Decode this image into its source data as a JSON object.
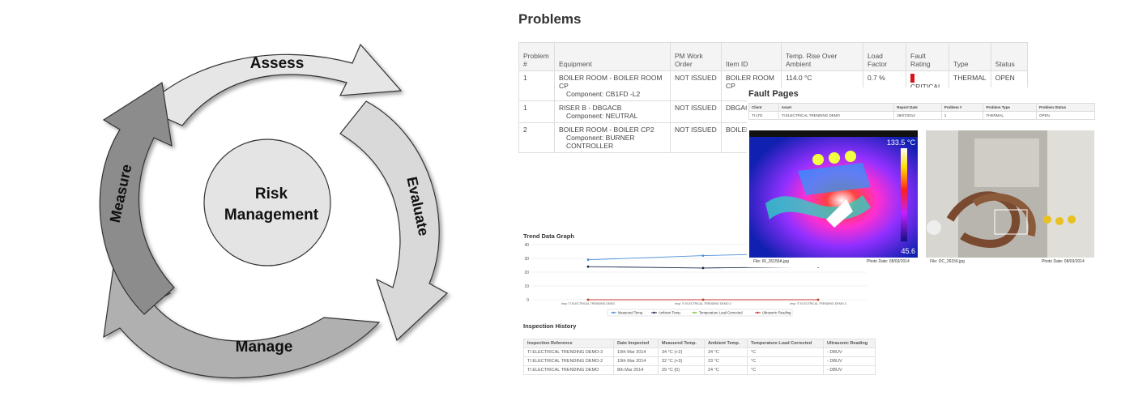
{
  "cycle": {
    "center_line1": "Risk",
    "center_line2": "Management",
    "assess": "Assess",
    "evaluate": "Evaluate",
    "manage": "Manage",
    "measure": "Measure"
  },
  "problems": {
    "title": "Problems",
    "headers": [
      "Problem #",
      "Equipment",
      "PM Work Order",
      "Item ID",
      "Temp. Rise Over Ambient",
      "Load Factor",
      "Fault Rating",
      "Type",
      "Status"
    ],
    "rows": [
      {
        "num": "1",
        "equipment": "BOILER ROOM - BOILER ROOM CP",
        "component": "Component: CB1FD -L2",
        "pm": "NOT ISSUED",
        "item": "BOILER ROOM CP",
        "rise": "114.0 °C",
        "load": "0.7 %",
        "rating": "CRITICAL",
        "type": "THERMAL",
        "status": "OPEN"
      },
      {
        "num": "1",
        "equipment": "RISER B - DBGACB",
        "component": "Component: NEUTRAL",
        "pm": "NOT ISSUED",
        "item": "DBGAC",
        "rise": "",
        "load": "",
        "rating": "",
        "type": "",
        "status": ""
      },
      {
        "num": "2",
        "equipment": "BOILER ROOM - BOILER CP2",
        "component": "Component: BURNER CONTROLLER",
        "pm": "NOT ISSUED",
        "item": "BOILER",
        "rise": "",
        "load": "",
        "rating": "",
        "type": "",
        "status": ""
      }
    ]
  },
  "trend": {
    "title": "Trend Data Graph",
    "chart_data": {
      "type": "line",
      "categories": [
        "Insp: TI ELECTRICAL TRENDING DEMO",
        "Insp: TI ELECTRICAL TRENDING DEMO-2",
        "Insp: TI ELECTRICAL TRENDING DEMO-3"
      ],
      "ylim": [
        0,
        40
      ],
      "yticks": [
        "0",
        "10",
        "20",
        "30",
        "40"
      ],
      "series": [
        {
          "name": "Measured Temp.",
          "color": "#4a90d9",
          "values": [
            29,
            32,
            34
          ]
        },
        {
          "name": "Ambient Temp.",
          "color": "#1a2a4a",
          "values": [
            24,
            23,
            24
          ]
        },
        {
          "name": "Temperature Load Corrected",
          "color": "#8bc34a",
          "values": [
            0,
            0,
            0
          ]
        },
        {
          "name": "Ultrasonic Reading",
          "color": "#c0392b",
          "values": [
            0,
            0,
            0
          ]
        }
      ]
    }
  },
  "history": {
    "title": "Inspection History",
    "headers": [
      "Inspection Reference",
      "Date Inspected",
      "Measured Temp.",
      "Ambient Temp.",
      "Temperature Load Corrected",
      "Ultrasonic Reading"
    ],
    "rows": [
      [
        "TI ELECTRICAL TRENDING DEMO-3",
        "10th Mar 2014",
        "34 °C (+2)",
        "24 °C",
        "°C",
        "- DBUV"
      ],
      [
        "TI ELECTRICAL TRENDING DEMO-2",
        "10th Mar 2014",
        "32 °C (+3)",
        "23 °C",
        "°C",
        "- DBUV"
      ],
      [
        "TI ELECTRICAL TRENDING DEMO",
        "8th Mar 2014",
        "29 °C (0)",
        "24 °C",
        "°C",
        "- DBUV"
      ]
    ]
  },
  "fault": {
    "title": "Fault Pages",
    "headers": [
      "Client",
      "Asset",
      "Report Date",
      "Problem #",
      "Problem Type",
      "Problem Status"
    ],
    "row": [
      "TI LTD",
      "TI ELECTRICAL TRENDING DEMO",
      "26/07/2014",
      "1",
      "THERMAL",
      "OPEN"
    ],
    "thermal": {
      "max": "133.5 °C",
      "min": "45.6",
      "file": "File: IR_26155A.jpg",
      "date": "Photo Date: 08/03/2014"
    },
    "visual": {
      "file": "File: DC_26156.jpg",
      "date": "Photo Date: 08/03/2014"
    }
  }
}
